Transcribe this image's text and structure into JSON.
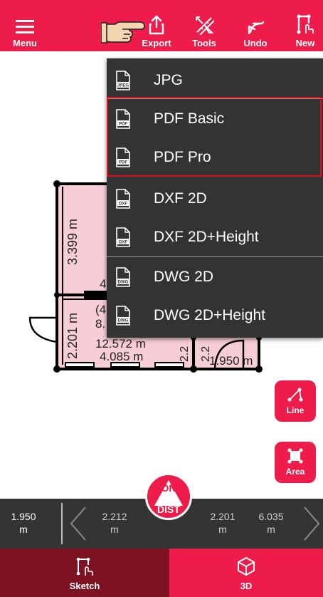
{
  "toolbar": {
    "menu_label": "Menu",
    "export_label": "Export",
    "tools_label": "Tools",
    "undo_label": "Undo",
    "new_label": "New"
  },
  "export_menu": {
    "items": [
      {
        "label": "JPG",
        "badge": "JPEG"
      },
      {
        "label": "PDF Basic",
        "badge": "PDF"
      },
      {
        "label": "PDF Pro",
        "badge": "PDF"
      },
      {
        "label": "DXF 2D",
        "badge": "DXF"
      },
      {
        "label": "DXF 2D+Height",
        "badge": "DXF"
      },
      {
        "label": "DWG 2D",
        "badge": "DWG"
      },
      {
        "label": "DWG 2D+Height",
        "badge": "DWG"
      }
    ]
  },
  "floorplan": {
    "dim_top_room_height": "3.399 m",
    "dim_lower_room_height": "2.201 m",
    "fragment_a": "4",
    "fragment_b": "(4",
    "fragment_c": "8.",
    "area_text": "12.572 m",
    "width_text": "4.085 m",
    "small_dim": "2.2",
    "small_dim_2": "2.2",
    "door_width": "1.950 m"
  },
  "tools": {
    "line_label": "Line",
    "area_label": "Area"
  },
  "measurements": {
    "current_value": "1.950",
    "current_unit": "m",
    "items": [
      {
        "value": "2.212",
        "unit": "m"
      },
      {
        "value": "2.201",
        "unit": "m"
      },
      {
        "value": "6.035",
        "unit": "m"
      }
    ]
  },
  "dist_button": {
    "line1": "ON",
    "line2": "DIST"
  },
  "bottom_nav": {
    "sketch_label": "Sketch",
    "three_d_label": "3D"
  },
  "colors": {
    "brand_red": "#ee1c4a",
    "menu_bg": "#333333",
    "highlight_border": "#e0101f",
    "room_fill": "#f7cdd6",
    "measure_bar": "#343434",
    "sketch_tab": "#7d1223"
  }
}
